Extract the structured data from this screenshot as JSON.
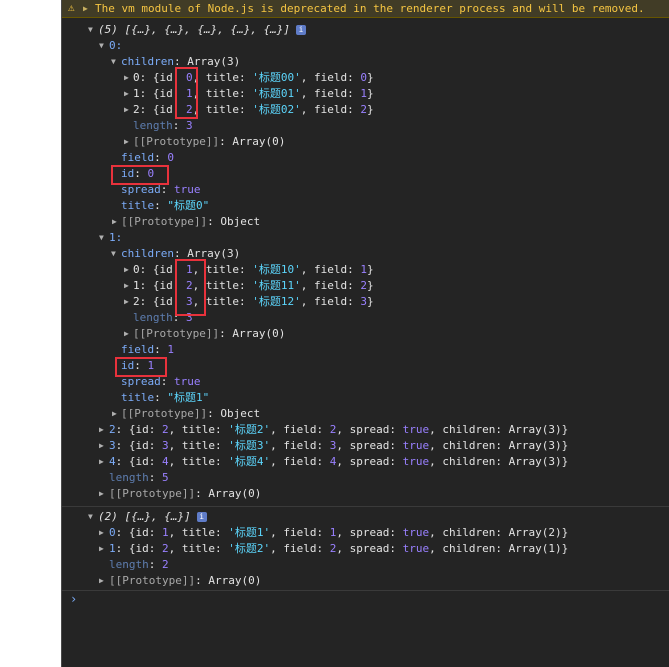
{
  "warning": {
    "icon": "warning-triangle-icon",
    "text": "The vm module of Node.js is deprecated in the renderer process and will be removed."
  },
  "log1": {
    "summary": "(5) [{…}, {…}, {…}, {…}, {…}]",
    "badge": "i",
    "item0": {
      "index": "0:",
      "children_key": "children",
      "children_val": "Array(3)",
      "children": [
        {
          "idx": "0",
          "id": "0",
          "title": "'标题00'",
          "field": "0"
        },
        {
          "idx": "1",
          "id": "1",
          "title": "'标题01'",
          "field": "1"
        },
        {
          "idx": "2",
          "id": "2",
          "title": "'标题02'",
          "field": "2"
        }
      ],
      "length": "3",
      "proto_val": "Array(0)",
      "field": "0",
      "id": "0",
      "spread": "true",
      "title": "\"标题0\"",
      "proto2": "Object"
    },
    "item1": {
      "index": "1:",
      "children_key": "children",
      "children_val": "Array(3)",
      "children": [
        {
          "idx": "0",
          "id": "1",
          "title": "'标题10'",
          "field": "1"
        },
        {
          "idx": "1",
          "id": "2",
          "title": "'标题11'",
          "field": "2"
        },
        {
          "idx": "2",
          "id": "3",
          "title": "'标题12'",
          "field": "3"
        }
      ],
      "length": "3",
      "proto_val": "Array(0)",
      "field": "1",
      "id": "1",
      "spread": "true",
      "title": "\"标题1\"",
      "proto2": "Object"
    },
    "collapsed": [
      {
        "idx": "2",
        "id": "2",
        "title": "'标题2'",
        "field": "2",
        "spread": "true",
        "children": "Array(3)"
      },
      {
        "idx": "3",
        "id": "3",
        "title": "'标题3'",
        "field": "3",
        "spread": "true",
        "children": "Array(3)"
      },
      {
        "idx": "4",
        "id": "4",
        "title": "'标题4'",
        "field": "4",
        "spread": "true",
        "children": "Array(3)"
      }
    ],
    "length": "5",
    "proto_val": "Array(0)"
  },
  "log2": {
    "summary": "(2) [{…}, {…}]",
    "badge": "i",
    "items": [
      {
        "idx": "0",
        "id": "1",
        "title": "'标题1'",
        "field": "1",
        "spread": "true",
        "children": "Array(2)"
      },
      {
        "idx": "1",
        "id": "2",
        "title": "'标题2'",
        "field": "2",
        "spread": "true",
        "children": "Array(1)"
      }
    ],
    "length": "2",
    "proto_val": "Array(0)"
  },
  "labels": {
    "id": "id",
    "title": "title",
    "field": "field",
    "spread": "spread",
    "children": "children",
    "length": "length",
    "proto": "[[Prototype]]",
    "colon": ": ",
    "comma": ", ",
    "open": "{",
    "close": "}",
    "idopen": "{id"
  },
  "prompt": "›"
}
